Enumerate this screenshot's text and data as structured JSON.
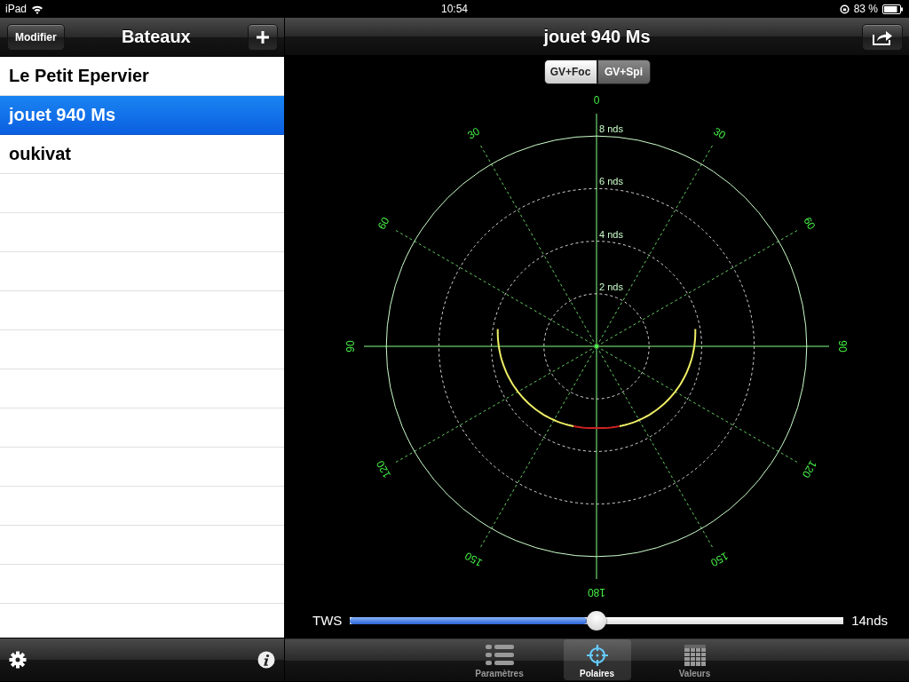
{
  "status_bar": {
    "device": "iPad",
    "time": "10:54",
    "battery": "83 %"
  },
  "sidebar": {
    "edit_button": "Modifier",
    "title": "Bateaux",
    "items": [
      {
        "label": "Le Petit Epervier",
        "selected": false
      },
      {
        "label": "jouet 940 Ms",
        "selected": true
      },
      {
        "label": "oukivat",
        "selected": false
      }
    ]
  },
  "detail": {
    "title": "jouet 940 Ms",
    "segments": [
      {
        "label": "GV+Foc",
        "selected": true
      },
      {
        "label": "GV+Spi",
        "selected": false
      }
    ],
    "polar": {
      "angle_labels": [
        "0",
        "30",
        "60",
        "90",
        "120",
        "150",
        "180",
        "150",
        "120",
        "90",
        "60",
        "30"
      ],
      "ring_labels": [
        "8 nds",
        "6 nds",
        "4 nds",
        "2 nds"
      ]
    },
    "slider": {
      "label": "TWS",
      "level": 0.5,
      "reading": "14nds"
    }
  },
  "tab_bar": [
    {
      "label": "Paramètres",
      "selected": false
    },
    {
      "label": "Polaires",
      "selected": true
    },
    {
      "label": "Valeurs",
      "selected": false
    }
  ]
}
